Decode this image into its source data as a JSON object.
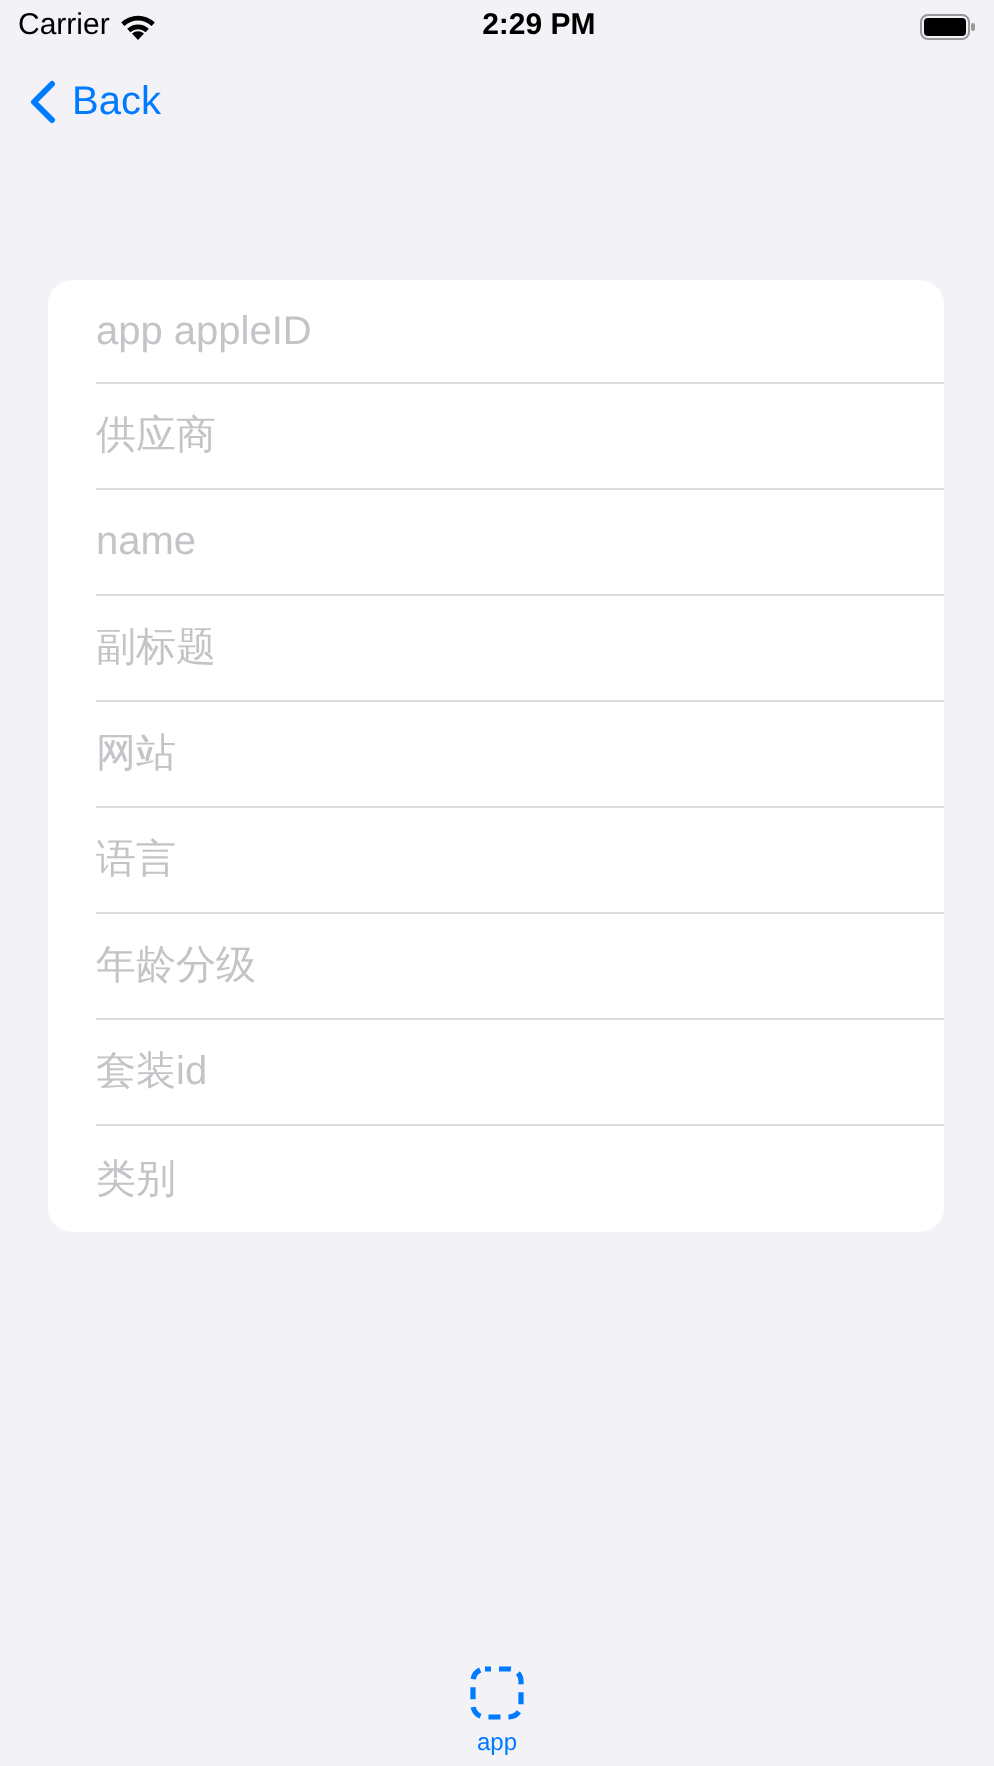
{
  "status_bar": {
    "carrier": "Carrier",
    "time": "2:29 PM"
  },
  "nav": {
    "back": "Back"
  },
  "form": {
    "fields": [
      {
        "placeholder": "app appleID"
      },
      {
        "placeholder": "供应商"
      },
      {
        "placeholder": "name"
      },
      {
        "placeholder": "副标题"
      },
      {
        "placeholder": "网站"
      },
      {
        "placeholder": "语言"
      },
      {
        "placeholder": "年龄分级"
      },
      {
        "placeholder": "套装id"
      },
      {
        "placeholder": "类别"
      }
    ]
  },
  "tab_bar": {
    "tabs": [
      {
        "label": "app",
        "selected": true
      }
    ]
  }
}
